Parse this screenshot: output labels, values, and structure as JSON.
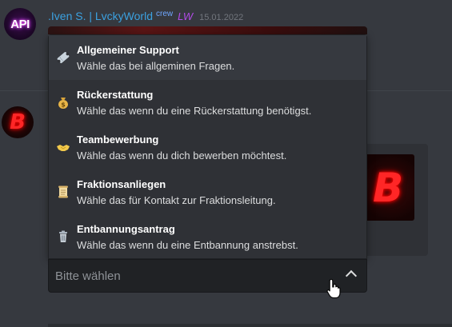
{
  "message": {
    "username": ".Iven S. | LvckyWorld",
    "crew_tag": "crew",
    "tag_emoji": "LW",
    "timestamp": "15.01.2022",
    "avatar_text": "API"
  },
  "bot": {
    "avatar_letter": "B",
    "thumbnail_letter": "B"
  },
  "select_menu": {
    "placeholder": "Bitte wählen",
    "options": [
      {
        "icon": "ticket-icon",
        "label": "Allgemeiner Support",
        "description": "Wähle das bei allgeminen Fragen."
      },
      {
        "icon": "money-bag-icon",
        "label": "Rückerstattung",
        "description": "Wähle das wenn du eine Rückerstattung benötigst."
      },
      {
        "icon": "handshake-icon",
        "label": "Teambewerbung",
        "description": "Wähle das wenn du dich bewerben möchtest."
      },
      {
        "icon": "scroll-icon",
        "label": "Fraktionsanliegen",
        "description": "Wähle das für Kontakt zur Fraktionsleitung."
      },
      {
        "icon": "trash-can-icon",
        "label": "Entbannungsantrag",
        "description": "Wähle das wenn du eine Entbannung anstrebst."
      }
    ]
  },
  "colors": {
    "background": "#36393f",
    "menu_background": "#2f3136",
    "username": "#3ba1e0",
    "accent_red": "#ff2626"
  }
}
